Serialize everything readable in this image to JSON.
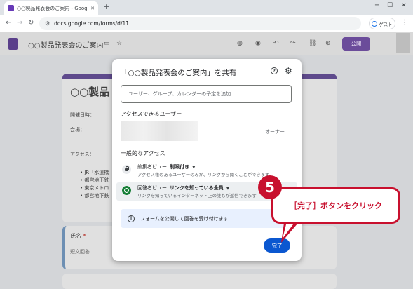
{
  "browser": {
    "tab_title": "○○製品発表会のご案内 - Goog",
    "url": "docs.google.com/forms/d/11",
    "profile_label": "ゲスト"
  },
  "app": {
    "doc_title": "○○製品発表会のご案内",
    "publish_label": "公開"
  },
  "form_bg": {
    "heading": "○○製品",
    "date_label": "開催日時：",
    "venue_label": "会場：",
    "access_label": "アクセス：",
    "bullets": [
      "JR「水道橋",
      "都営地下鉄",
      "東京メトロ",
      "都営地下鉄"
    ],
    "question_label": "氏名",
    "required_mark": "*",
    "answer_placeholder": "短文回答"
  },
  "dialog": {
    "title": "「○○製品発表会のご案内」を共有",
    "input_placeholder": "ユーザー、グループ、カレンダーの予定を追加",
    "people_heading": "アクセスできるユーザー",
    "owner_label": "オーナー",
    "general_heading": "一般的なアクセス",
    "editor": {
      "role": "編集者ビュー",
      "setting": "制限付き",
      "description": "アクセス権のあるユーザーのみが、リンクから開くことができます"
    },
    "responder": {
      "role": "回答者ビュー",
      "setting": "リンクを知っている全員",
      "description": "リンクを知っているインターネット上の誰もが返信できます"
    },
    "info_text": "フォームを公開して回答を受け付けます",
    "done_label": "完了"
  },
  "annotation": {
    "step_number": "5",
    "text": "［完了］ボタンをクリック",
    "color": "#c8102e"
  }
}
